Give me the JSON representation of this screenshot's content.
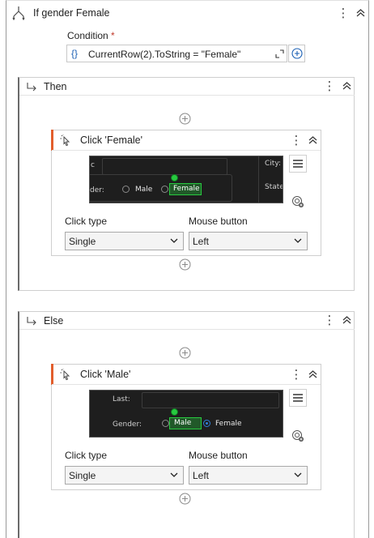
{
  "if_activity": {
    "title": "If gender Female",
    "condition_label": "Condition",
    "condition_required": "*",
    "condition_value": "CurrentRow(2).ToString = \"Female\"",
    "condition_prefix_icon": "{}"
  },
  "then_branch": {
    "title": "Then",
    "click_activity": {
      "title": "Click 'Female'",
      "click_type_label": "Click type",
      "click_type_value": "Single",
      "mouse_button_label": "Mouse button",
      "mouse_button_value": "Left",
      "screenshot": {
        "field_text": "der:",
        "radio1": "Male",
        "radio2": "Female",
        "right_text1": "City:",
        "right_text2": "State",
        "top_left_text": "c"
      }
    }
  },
  "else_branch": {
    "title": "Else",
    "click_activity": {
      "title": "Click 'Male'",
      "click_type_label": "Click type",
      "click_type_value": "Single",
      "mouse_button_label": "Mouse button",
      "mouse_button_value": "Left",
      "screenshot": {
        "last_label": "Last:",
        "gender_label": "Gender:",
        "radio1": "Male",
        "radio2": "Female"
      }
    }
  },
  "colors": {
    "accent_orange": "#e25e2c",
    "target_green": "#27c93f",
    "link_blue": "#1a5fb4"
  }
}
